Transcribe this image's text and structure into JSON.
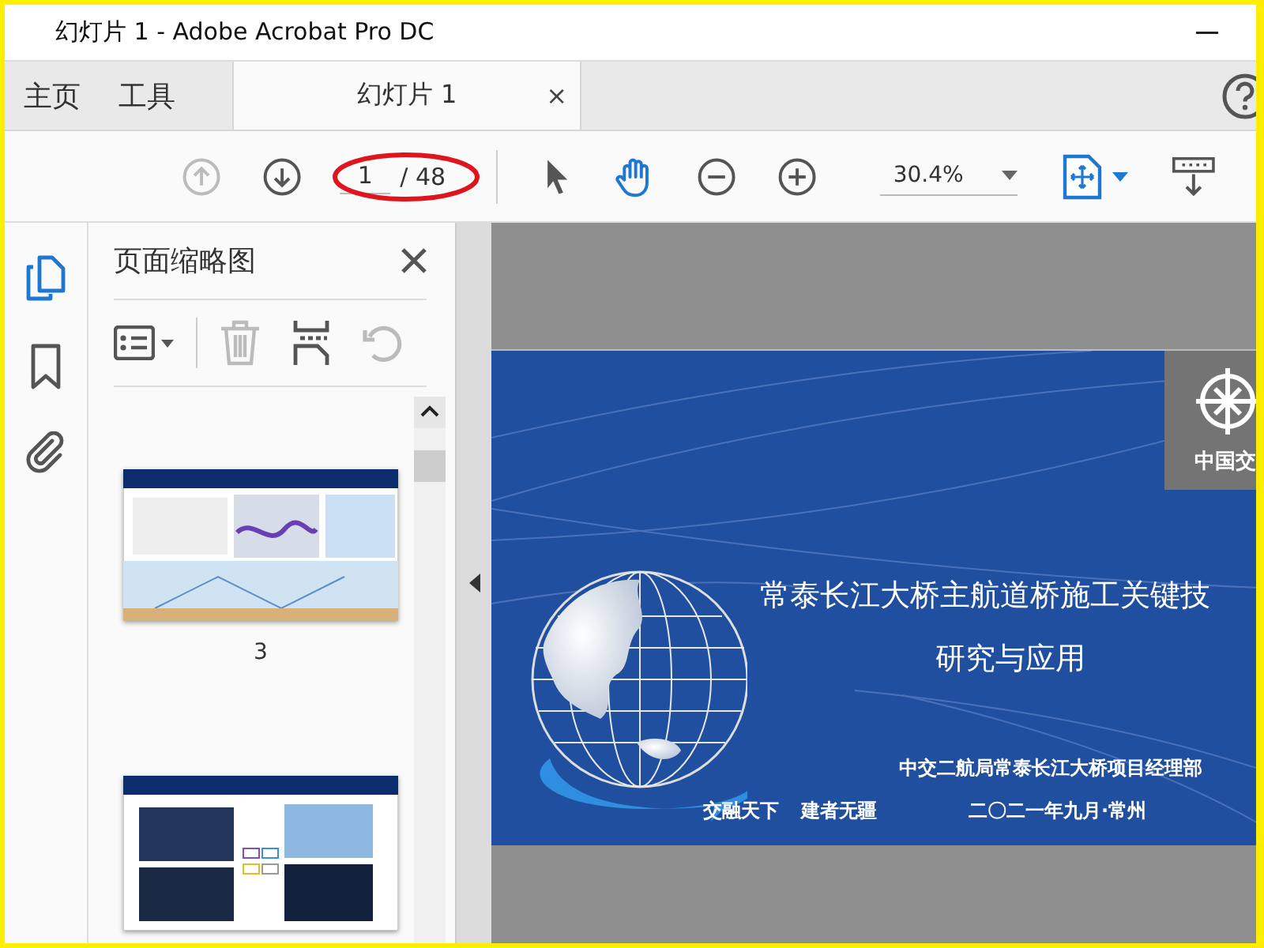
{
  "window": {
    "title": "幻灯片 1 - Adobe Acrobat Pro DC"
  },
  "tabs": [
    {
      "label": "主页",
      "selected": false
    },
    {
      "label": "工具",
      "selected": false
    },
    {
      "label": "幻灯片 1",
      "selected": true,
      "close": "×"
    }
  ],
  "toolbar": {
    "prev_page": {
      "disabled": true
    },
    "next_page": {
      "disabled": false
    },
    "page_current": "1",
    "page_total": "/ 48",
    "zoom": "30.4%"
  },
  "sidebar": {
    "items": [
      {
        "kind": "pages",
        "selected": true
      },
      {
        "kind": "bookmarks",
        "selected": false
      },
      {
        "kind": "attachments",
        "selected": false
      }
    ]
  },
  "panel": {
    "title": "页面缩略图",
    "tools": [
      {
        "kind": "options",
        "disabled": false
      },
      {
        "kind": "delete",
        "disabled": true
      },
      {
        "kind": "insert",
        "disabled": false
      },
      {
        "kind": "rotate",
        "disabled": true
      }
    ],
    "thumbnails": [
      {
        "kind": "map",
        "label": "3"
      },
      {
        "kind": "photos"
      }
    ]
  },
  "slide": {
    "logo_text": "中国交",
    "title_lines": [
      "常泰长江大桥主航道桥施工关键技",
      "研究与应用"
    ],
    "slogan": [
      "交融天下",
      "建者无疆"
    ],
    "organization": "中交二航局常泰长江大桥项目经理部",
    "date": "二〇二一年九月·常州"
  }
}
